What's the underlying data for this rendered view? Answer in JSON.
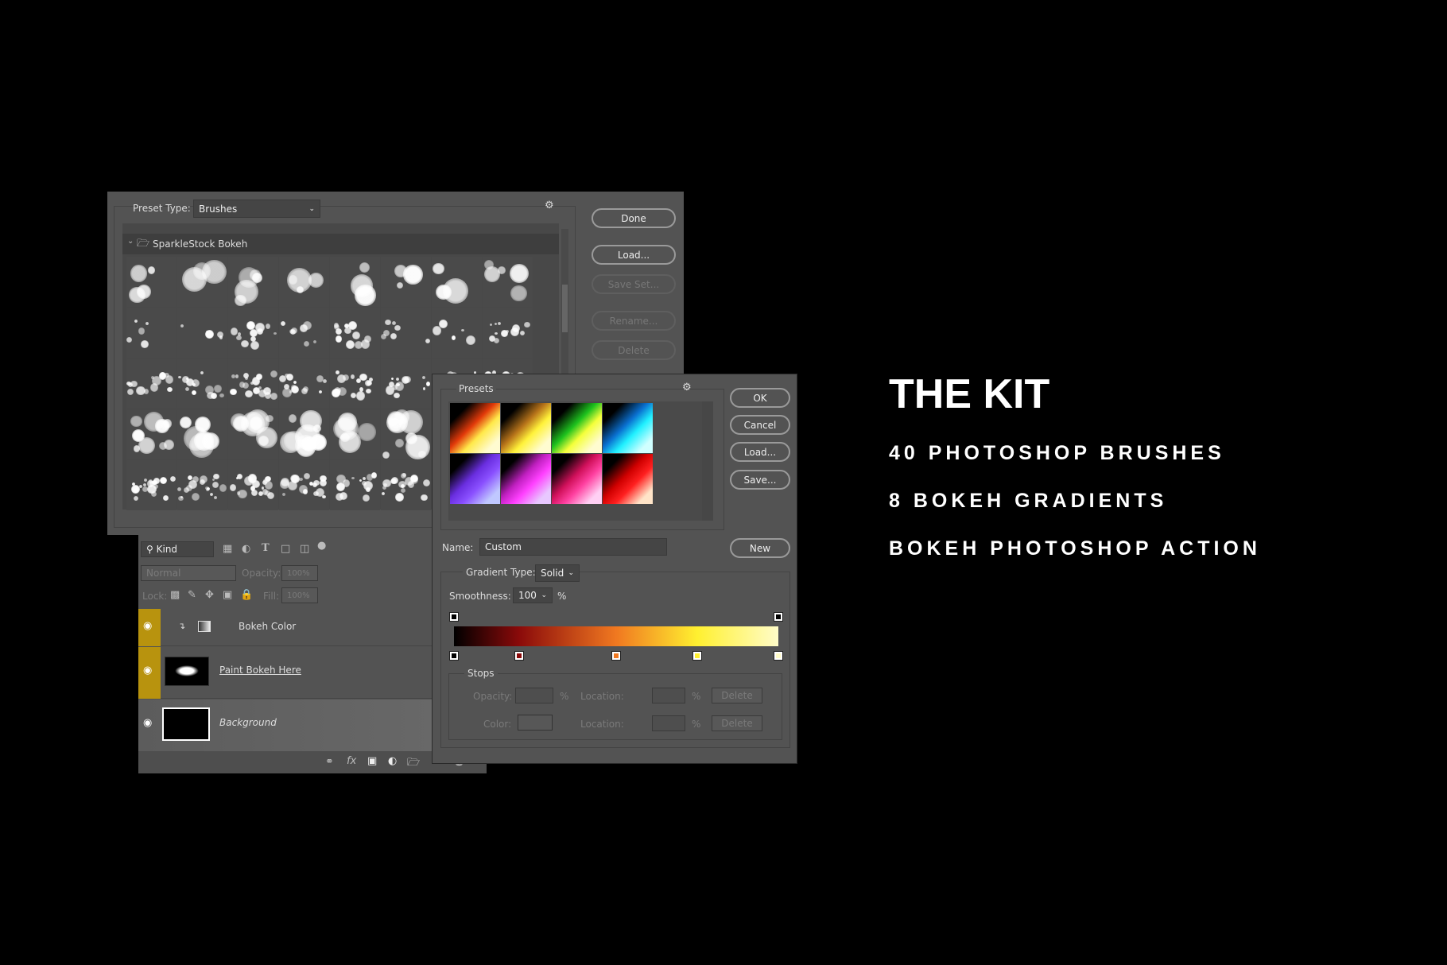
{
  "preset_manager": {
    "preset_type_label": "Preset Type:",
    "preset_type_value": "Brushes",
    "folder_name": "SparkleStock Bokeh",
    "buttons": {
      "done": "Done",
      "load": "Load...",
      "save_set": "Save Set...",
      "rename": "Rename...",
      "delete": "Delete"
    },
    "brush_count": 40
  },
  "layers": {
    "filter_kind": "Kind",
    "blend_mode": "Normal",
    "opacity_label": "Opacity:",
    "opacity_value": "100%",
    "lock_label": "Lock:",
    "fill_label": "Fill:",
    "fill_value": "100%",
    "items": [
      {
        "name": "Bokeh Color",
        "visible": true,
        "highlight": "#b8930e"
      },
      {
        "name": "Paint Bokeh Here",
        "visible": true,
        "highlight": "#b8930e"
      },
      {
        "name": "Background",
        "visible": true
      }
    ]
  },
  "gradient_editor": {
    "presets_label": "Presets",
    "buttons": {
      "ok": "OK",
      "cancel": "Cancel",
      "load": "Load...",
      "save": "Save...",
      "new": "New"
    },
    "name_label": "Name:",
    "name_value": "Custom",
    "gradient_type_label": "Gradient Type:",
    "gradient_type_value": "Solid",
    "smoothness_label": "Smoothness:",
    "smoothness_value": "100",
    "pct": "%",
    "stops_label": "Stops",
    "opacity_label": "Opacity:",
    "color_label": "Color:",
    "location_label": "Location:",
    "delete": "Delete",
    "presets": [
      [
        "#000",
        "#e23a0a",
        "#ffe94a",
        "#fffbd0"
      ],
      [
        "#000",
        "#b8741a",
        "#fff23a",
        "#fffcd0"
      ],
      [
        "#000",
        "#1ec21e",
        "#f4ff3a",
        "#fffcd0"
      ],
      [
        "#000",
        "#0a70d0",
        "#20f0ff",
        "#d0ffff"
      ],
      [
        "#000",
        "#6a2ee0",
        "#8a50ff",
        "#c0c8ff"
      ],
      [
        "#000",
        "#c020c0",
        "#ff40ff",
        "#e8c8ff"
      ],
      [
        "#000",
        "#d0105a",
        "#ff40a0",
        "#ffd0f4"
      ],
      [
        "#000",
        "#d00000",
        "#ff2020",
        "#ffe4c8"
      ]
    ],
    "color_stops": [
      {
        "loc": 0,
        "color": "#000000"
      },
      {
        "loc": 20,
        "color": "#8a0a0a"
      },
      {
        "loc": 50,
        "color": "#f07820"
      },
      {
        "loc": 75,
        "color": "#fff030"
      },
      {
        "loc": 100,
        "color": "#fffcc8"
      }
    ],
    "opacity_stops": [
      0,
      100
    ]
  },
  "promo": {
    "title": "THE KIT",
    "lines": [
      "40 PHOTOSHOP BRUSHES",
      "8 BOKEH GRADIENTS",
      "BOKEH PHOTOSHOP ACTION"
    ]
  }
}
